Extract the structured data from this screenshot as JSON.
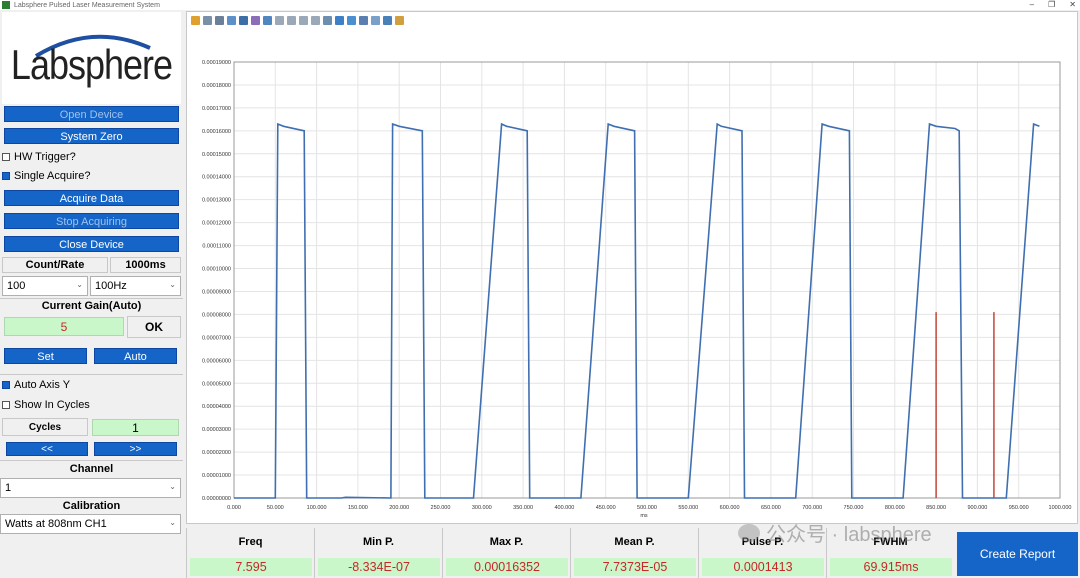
{
  "window": {
    "title": "Labsphere Pulsed Laser Measurement System",
    "controls": [
      "–",
      "❐",
      "✕"
    ]
  },
  "logo": {
    "text": "Labsphere",
    "arc_color": "#1f4fa0"
  },
  "buttons": {
    "open_device": "Open Device",
    "system_zero": "System Zero",
    "acquire_data": "Acquire Data",
    "stop_acquiring": "Stop Acquiring",
    "close_device": "Close Device",
    "set": "Set",
    "auto": "Auto",
    "prev": "<<",
    "next": ">>",
    "ok": "OK",
    "create_report": "Create Report"
  },
  "checkboxes": {
    "hw_trigger": {
      "label": "HW Trigger?",
      "checked": false
    },
    "single_acquire": {
      "label": "Single Acquire?",
      "checked": true
    },
    "auto_axis_y": {
      "label": "Auto Axis Y",
      "checked": true
    },
    "show_in_cycles": {
      "label": "Show In Cycles",
      "checked": false
    }
  },
  "count_rate": {
    "label": "Count/Rate",
    "time": "1000ms",
    "count_value": "100",
    "rate_value": "100Hz"
  },
  "gain": {
    "label": "Current Gain(Auto)",
    "value": "5"
  },
  "cycles": {
    "label": "Cycles",
    "value": "1"
  },
  "channel": {
    "label": "Channel",
    "value": "1"
  },
  "calibration": {
    "label": "Calibration",
    "value": "Watts at 808nm CH1"
  },
  "stats": [
    {
      "label": "Freq",
      "value": "7.595"
    },
    {
      "label": "Min P.",
      "value": "-8.334E-07"
    },
    {
      "label": "Max P.",
      "value": "0.00016352"
    },
    {
      "label": "Mean P.",
      "value": "7.7373E-05"
    },
    {
      "label": "Pulse P.",
      "value": "0.0001413"
    },
    {
      "label": "FWHM",
      "value": "69.915ms"
    }
  ],
  "watermark": {
    "text": "公众号 · labsphere"
  },
  "colors": {
    "accent": "#1565c8",
    "trace": "#3f6fb0",
    "marker": "#c0392b",
    "value_bg": "#c9f7c9",
    "value_text": "#c62828"
  },
  "chart_data": {
    "type": "line",
    "xlabel": "ms",
    "ylabel": "",
    "xlim": [
      0,
      1000
    ],
    "ylim": [
      0,
      0.00019
    ],
    "x_ticks": [
      "0.000",
      "50.000",
      "100.000",
      "150.000",
      "200.000",
      "250.000",
      "300.000",
      "350.000",
      "400.000",
      "450.000",
      "500.000",
      "550.000",
      "600.000",
      "650.000",
      "700.000",
      "750.000",
      "800.000",
      "850.000",
      "900.000",
      "950.000",
      "1000.000"
    ],
    "y_ticks": [
      "0.00000000",
      "0.00001000",
      "0.00002000",
      "0.00003000",
      "0.00004000",
      "0.00005000",
      "0.00006000",
      "0.00007000",
      "0.00008000",
      "0.00009000",
      "0.00010000",
      "0.00011000",
      "0.00012000",
      "0.00013000",
      "0.00014000",
      "0.00015000",
      "0.00016000",
      "0.00017000",
      "0.00018000",
      "0.00019000"
    ],
    "grid": true,
    "series": [
      {
        "points": [
          [
            0,
            0
          ],
          [
            50,
            0
          ],
          [
            53,
            0.000163
          ],
          [
            60,
            0.000162
          ],
          [
            85,
            0.00016
          ],
          [
            88,
            0
          ],
          [
            130,
            0
          ],
          [
            135,
            3e-07
          ],
          [
            190,
            0
          ],
          [
            192,
            0.000163
          ],
          [
            200,
            0.000162
          ],
          [
            228,
            0.00016
          ],
          [
            231,
            0
          ],
          [
            260,
            0
          ],
          [
            290,
            0
          ],
          [
            324,
            0.000163
          ],
          [
            330,
            0.000162
          ],
          [
            355,
            0.00016
          ],
          [
            358,
            0
          ],
          [
            390,
            0
          ],
          [
            420,
            0
          ],
          [
            453,
            0.000163
          ],
          [
            460,
            0.000162
          ],
          [
            485,
            0.00016
          ],
          [
            488,
            0
          ],
          [
            520,
            0
          ],
          [
            550,
            0
          ],
          [
            585,
            0.000163
          ],
          [
            590,
            0.000162
          ],
          [
            615,
            0.00016
          ],
          [
            618,
            0
          ],
          [
            650,
            0
          ],
          [
            680,
            0
          ],
          [
            712,
            0.000163
          ],
          [
            720,
            0.000162
          ],
          [
            745,
            0.00016
          ],
          [
            748,
            0
          ],
          [
            780,
            0
          ],
          [
            810,
            0
          ],
          [
            842,
            0.000163
          ],
          [
            850,
            0.000162
          ],
          [
            873,
            0.000161
          ],
          [
            878,
            0.00016
          ],
          [
            882,
            0
          ],
          [
            910,
            0
          ],
          [
            935,
            0
          ],
          [
            968,
            0.000163
          ],
          [
            975,
            0.000162
          ]
        ]
      }
    ],
    "markers": [
      {
        "x": 850,
        "y": 8.1e-05
      },
      {
        "x": 920,
        "y": 8.1e-05
      }
    ]
  }
}
